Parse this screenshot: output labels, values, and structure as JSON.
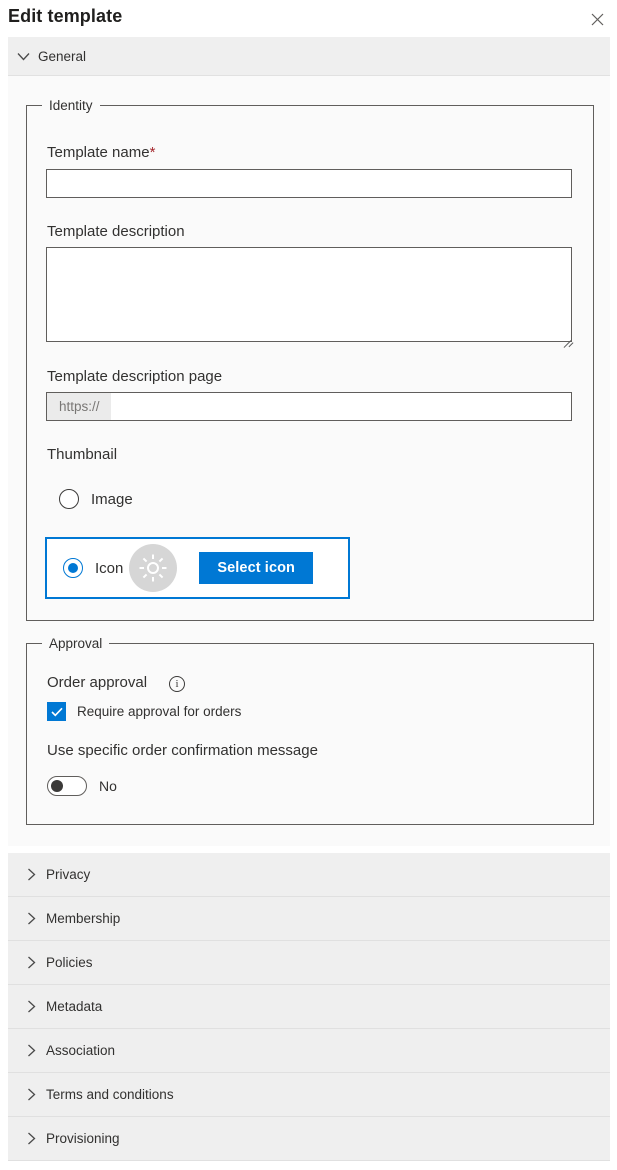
{
  "header": {
    "title": "Edit template",
    "close_icon": "close-icon"
  },
  "general_section": {
    "label": "General",
    "expanded": true,
    "chevron_icon": "chevron-down-icon"
  },
  "identity": {
    "legend": "Identity",
    "template_name": {
      "label": "Template name",
      "required_marker": "*",
      "value": "",
      "placeholder": ""
    },
    "template_description": {
      "label": "Template description",
      "value": "",
      "placeholder": ""
    },
    "template_description_page": {
      "label": "Template description page",
      "prefix": "https://",
      "value": "",
      "placeholder": ""
    },
    "thumbnail": {
      "label": "Thumbnail",
      "options": [
        {
          "label": "Image",
          "selected": false
        },
        {
          "label": "Icon",
          "selected": true
        }
      ],
      "icon_preview": "sun-icon",
      "select_icon_button": "Select icon"
    }
  },
  "approval": {
    "legend": "Approval",
    "order_approval": {
      "label": "Order approval",
      "info_icon": "info-icon",
      "checkbox_label": "Require approval for orders",
      "checked": true
    },
    "confirmation_message": {
      "label": "Use specific order confirmation message",
      "toggle_value": "No",
      "enabled": false
    }
  },
  "collapsed_sections": [
    {
      "label": "Privacy",
      "chevron_icon": "chevron-right-icon"
    },
    {
      "label": "Membership",
      "chevron_icon": "chevron-right-icon"
    },
    {
      "label": "Policies",
      "chevron_icon": "chevron-right-icon"
    },
    {
      "label": "Metadata",
      "chevron_icon": "chevron-right-icon"
    },
    {
      "label": "Association",
      "chevron_icon": "chevron-right-icon"
    },
    {
      "label": "Terms and conditions",
      "chevron_icon": "chevron-right-icon"
    },
    {
      "label": "Provisioning",
      "chevron_icon": "chevron-right-icon"
    }
  ],
  "colors": {
    "accent": "#0078d4",
    "required": "#a4262c",
    "section_band": "#efefef",
    "body_bg": "#fafafa",
    "border": "#605e5c"
  }
}
